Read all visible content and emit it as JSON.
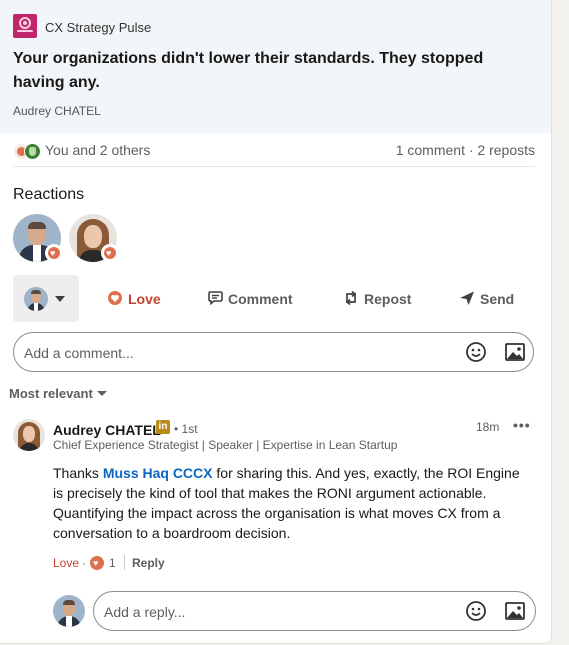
{
  "article": {
    "source_name": "CX Strategy Pulse",
    "title": "Your organizations didn't lower their standards. They stopped having any.",
    "author": "Audrey CHATEL"
  },
  "social": {
    "reactors_summary": "You and 2 others",
    "counts": "1 comment · 2 reposts"
  },
  "reactions": {
    "title": "Reactions"
  },
  "actions": {
    "love": "Love",
    "comment": "Comment",
    "repost": "Repost",
    "send": "Send"
  },
  "comment_input": {
    "placeholder": "Add a comment..."
  },
  "sort": {
    "label": "Most relevant"
  },
  "comment": {
    "author": "Audrey CHATEL",
    "badge": "in",
    "degree": "• 1st",
    "headline": "Chief Experience Strategist | Speaker | Expertise in Lean Startup",
    "time": "18m",
    "more": "•••",
    "text_before": "Thanks ",
    "mention": "Muss Haq CCCX",
    "text_after": " for sharing this. And yes, exactly, the ROI Engine is precisely the kind of tool that makes the RONI argument actionable. Quantifying the impact across the organisation is what moves CX from a conversation to a boardroom decision.",
    "love_label": "Love",
    "dot": "·",
    "love_count": "1",
    "reply_label": "Reply"
  },
  "reply_input": {
    "placeholder": "Add a reply..."
  },
  "colors": {
    "love": "#c3422b",
    "link": "#0a66c2",
    "premium_badge": "#b98c18"
  }
}
